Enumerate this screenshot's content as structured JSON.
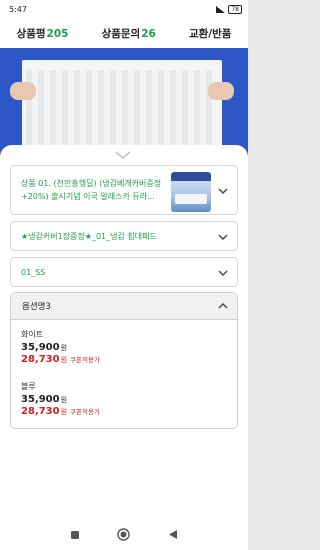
{
  "status": {
    "time": "5:47",
    "battery": "78"
  },
  "tabs": [
    {
      "label": "상품평",
      "count": "205"
    },
    {
      "label": "상품문의",
      "count": "26"
    },
    {
      "label": "교환/반품",
      "count": ""
    }
  ],
  "options": {
    "product": "상품 01. (천만흥행딜) (냉감베개커버증정+20%) 출시기념 이국 알래스카 듀라...",
    "gift": "★냉감커버1장증정★_01_냉감 침대패드",
    "size": "01_SS"
  },
  "option_list": {
    "title": "옵션명3",
    "items": [
      {
        "name": "화이트",
        "price": "35,900",
        "coupon_price": "28,730",
        "currency": "원",
        "coupon_label": "쿠폰적용가"
      },
      {
        "name": "블루",
        "price": "35,900",
        "coupon_price": "28,730",
        "currency": "원",
        "coupon_label": "쿠폰적용가"
      }
    ]
  },
  "icons": {
    "sheet_handle": "chevron-down-icon",
    "dropdown": "chevron-down-icon",
    "collapse": "chevron-up-icon",
    "nav_back": "triangle-back-icon",
    "nav_home": "circle-home-icon",
    "nav_recents": "square-recents-icon"
  },
  "colors": {
    "accent": "#1e9f4c",
    "price_red": "#d02121",
    "hero_bg": "#2d56c6"
  }
}
